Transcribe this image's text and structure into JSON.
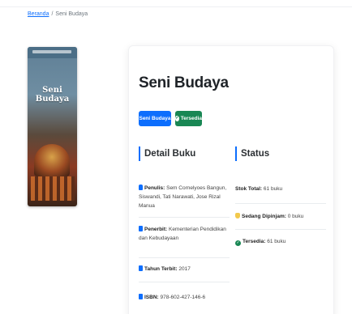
{
  "breadcrumb": {
    "home": "Beranda",
    "separator": "/",
    "current": "Seni Budaya"
  },
  "cover": {
    "title": "Seni Budaya"
  },
  "book": {
    "title": "Seni Budaya",
    "badges": {
      "category": "Seni Budaya",
      "availability": "Tersedia"
    }
  },
  "detail": {
    "heading": "Detail Buku",
    "penulis_label": "Penulis:",
    "penulis_value": "Sem Cornelyoes Bangun, Siswandi, Tati Narawati, Jose Rizal Manua",
    "penerbit_label": "Penerbit:",
    "penerbit_value": "Kementerian Pendidikan dan Kebudayaan",
    "tahun_label": "Tahun Terbit:",
    "tahun_value": "2017",
    "isbn_label": "ISBN:",
    "isbn_value": "978-602-427-146-6"
  },
  "status": {
    "heading": "Status",
    "stok_label": "Stok Total:",
    "stok_value": "61 buku",
    "dipinjam_label": "Sedang Dipinjam:",
    "dipinjam_value": "0 buku",
    "tersedia_label": "Tersedia:",
    "tersedia_value": "61 buku"
  },
  "colors": {
    "primary": "#0d6efd",
    "success": "#198754",
    "warning": "#f2c94c"
  },
  "icons": [
    "user-icon",
    "publisher-icon",
    "calendar-icon",
    "barcode-icon",
    "hand-icon",
    "check-circle-icon"
  ]
}
